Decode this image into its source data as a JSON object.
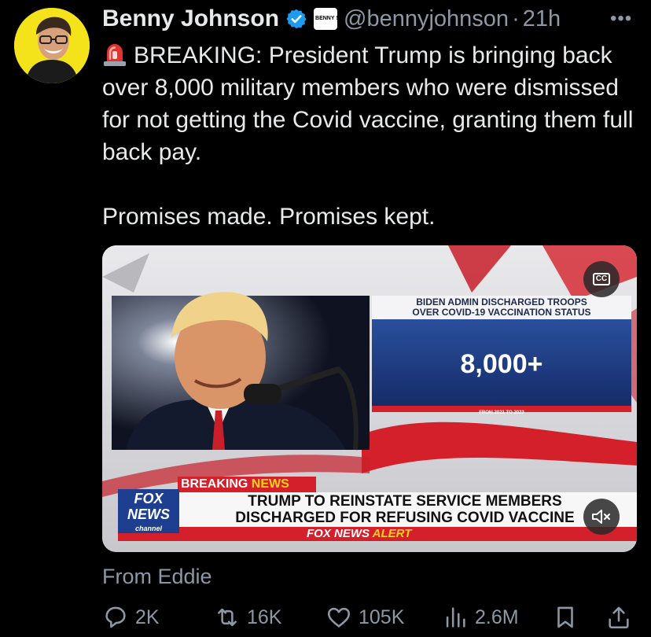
{
  "author": {
    "name": "Benny Johnson",
    "handle": "@bennyjohnson",
    "time_separator": "·",
    "time": "21h",
    "verified": true,
    "badge_text": "BENNY SHOW"
  },
  "tweet": {
    "paragraph1": "BREAKING: President Trump is bringing back over 8,000 military members who were dismissed for not getting the Covid vaccine, granting them full back pay.",
    "paragraph2": "Promises made. Promises kept."
  },
  "media": {
    "graphic_title_line1": "BIDEN ADMIN DISCHARGED TROOPS",
    "graphic_title_line2": "OVER COVID-19 VACCINATION STATUS",
    "graphic_value": "8,000+",
    "graphic_footnote": "FROM 2021 TO 2023",
    "breaking_label_1": "BREAKING",
    "breaking_label_2": "NEWS",
    "headline_line1": "TRUMP TO REINSTATE SERVICE MEMBERS",
    "headline_line2": "DISCHARGED FOR REFUSING COVID VACCINE",
    "alert_label_1": "FOX NEWS",
    "alert_label_2": "ALERT",
    "logo_line1": "FOX",
    "logo_line2": "NEWS",
    "logo_line3": "channel",
    "cc_label": "CC"
  },
  "attribution": "From Eddie",
  "actions": {
    "replies": "2K",
    "reposts": "16K",
    "likes": "105K",
    "views": "2.6M"
  },
  "colors": {
    "background": "#000000",
    "text": "#e7e9ea",
    "muted": "#8b98a5",
    "verified_blue": "#1d9bf0",
    "avatar_yellow": "#f4e21a",
    "fox_red": "#d4202a",
    "fox_blue": "#1e3f8f"
  }
}
